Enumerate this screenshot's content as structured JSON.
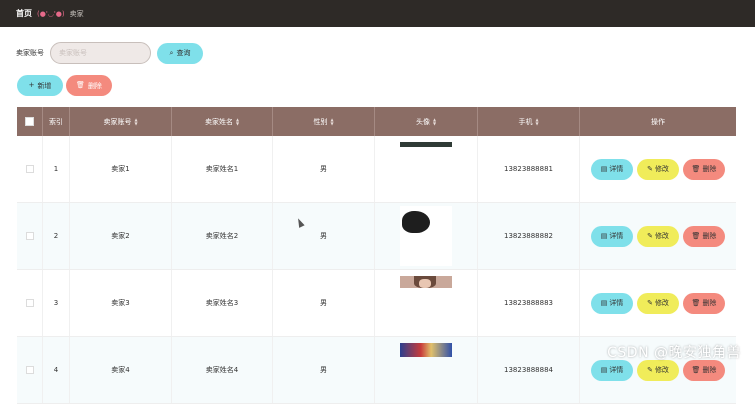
{
  "topbar": {
    "home": "首页",
    "emote": "(●'◡'●)",
    "crumb": "卖家"
  },
  "search": {
    "label": "卖家账号",
    "placeholder": "卖家账号",
    "query_label": "查询"
  },
  "actions": {
    "add_label": "新增",
    "delete_label": "删除"
  },
  "table": {
    "headers": {
      "index": "索引",
      "account": "卖家账号",
      "name": "卖家姓名",
      "gender": "性别",
      "avatar": "头像",
      "phone": "手机",
      "ops": "操作"
    },
    "rows": [
      {
        "index": "1",
        "account": "卖家1",
        "name": "卖家姓名1",
        "gender": "男",
        "phone": "13823888881",
        "avatar": "dark-strip"
      },
      {
        "index": "2",
        "account": "卖家2",
        "name": "卖家姓名2",
        "gender": "男",
        "phone": "13823888882",
        "avatar": "dark-hair"
      },
      {
        "index": "3",
        "account": "卖家3",
        "name": "卖家姓名3",
        "gender": "男",
        "phone": "13823888883",
        "avatar": "portrait"
      },
      {
        "index": "4",
        "account": "卖家4",
        "name": "卖家姓名4",
        "gender": "男",
        "phone": "13823888884",
        "avatar": "colorful"
      }
    ],
    "ops": {
      "detail": "详情",
      "edit": "修改",
      "delete": "删除"
    }
  },
  "colors": {
    "topbar": "#2e2a27",
    "header": "#8b6d65",
    "cyan": "#7fe0ea",
    "yellow": "#f0ec5a",
    "salmon": "#f48a7e"
  },
  "watermark": "CSDN @晚安独角兽"
}
